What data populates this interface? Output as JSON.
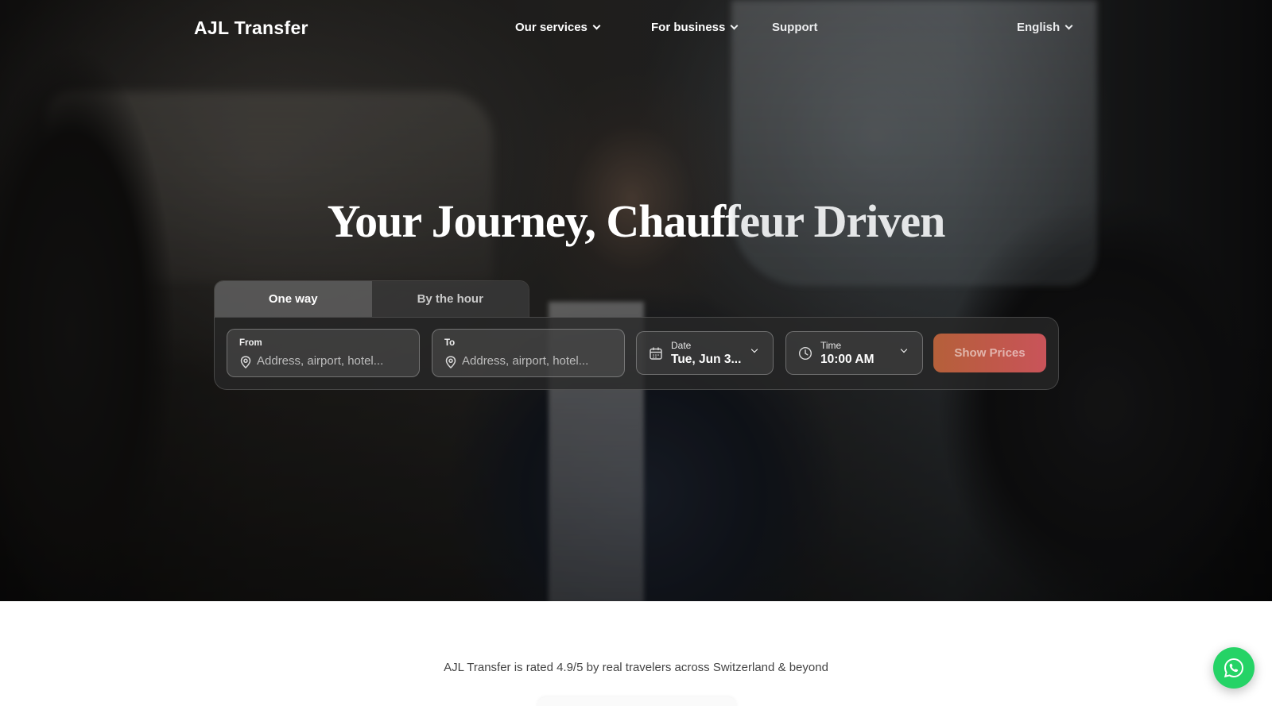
{
  "nav": {
    "logo": "AJL Transfer",
    "items": [
      {
        "label": "Our services",
        "has_dropdown": true
      },
      {
        "label": "For business",
        "has_dropdown": true
      },
      {
        "label": "Support",
        "has_dropdown": false
      }
    ],
    "language": "English"
  },
  "hero": {
    "headline": "Your Journey, Chauffeur Driven"
  },
  "booking": {
    "tabs": [
      {
        "label": "One way",
        "active": true
      },
      {
        "label": "By the hour",
        "active": false
      }
    ],
    "from": {
      "label": "From",
      "placeholder": "Address, airport, hotel..."
    },
    "to": {
      "label": "To",
      "placeholder": "Address, airport, hotel..."
    },
    "date": {
      "label": "Date",
      "value": "Tue, Jun 3..."
    },
    "time": {
      "label": "Time",
      "value": "10:00 AM"
    },
    "submit_label": "Show Prices"
  },
  "rating_text": "AJL Transfer is rated 4.9/5 by real travelers across Switzerland & beyond",
  "colors": {
    "accent_gradient_start": "#b5603a",
    "accent_gradient_end": "#c9545a",
    "whatsapp": "#25d366"
  },
  "icons": {
    "location": "map-pin-icon",
    "date": "calendar-icon",
    "time": "clock-icon",
    "chat": "whatsapp-icon"
  }
}
